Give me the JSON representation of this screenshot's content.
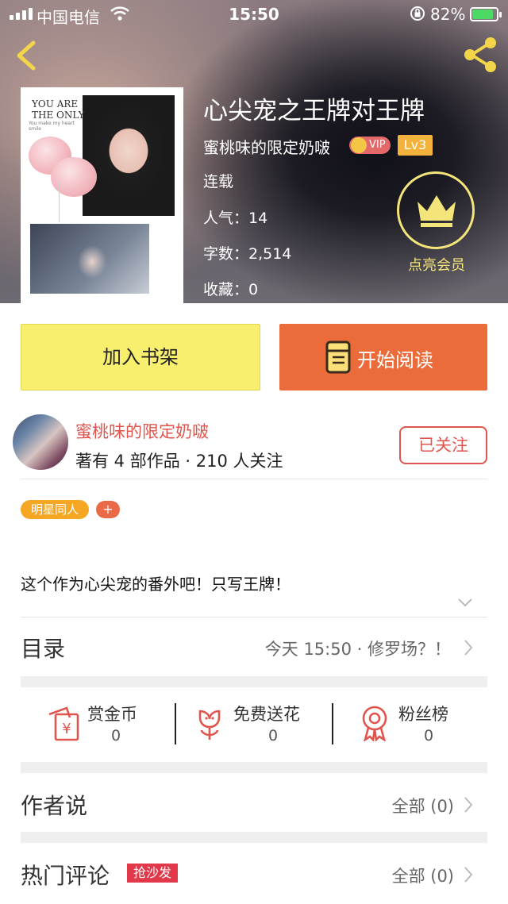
{
  "status_bar": {
    "carrier": "中国电信",
    "time": "15:50",
    "battery": "82%",
    "battery_level": 0.82
  },
  "book": {
    "title": "心尖宠之王牌对王牌",
    "author": "蜜桃味的限定奶啵",
    "vip_label": "VIP",
    "level": "Lv3",
    "status": "连载",
    "popularity": "人气：14",
    "word_count": "字数：2,514",
    "favorites": "收藏：0",
    "cover_text_title": "YOU ARE THE ONLY",
    "cover_text_sub": "You make my heart smile"
  },
  "membership": {
    "label": "点亮会员",
    "icon": "crown-icon"
  },
  "actions": {
    "add_shelf": "加入书架",
    "start_reading": "开始阅读"
  },
  "author_card": {
    "name": "蜜桃味的限定奶啵",
    "stats": "著有 4 部作品 · 210 人关注",
    "follow_label": "已关注"
  },
  "tags": {
    "items": [
      "明星同人"
    ],
    "add": "+"
  },
  "description": "这个作为心尖宠的番外吧！只写王牌！",
  "toc": {
    "title": "目录",
    "latest": "今天 15:50 · 修罗场？！"
  },
  "stats": {
    "coins": {
      "label": "赏金币",
      "value": "0"
    },
    "flowers": {
      "label": "免费送花",
      "value": "0"
    },
    "fans": {
      "label": "粉丝榜",
      "value": "0"
    }
  },
  "author_says": {
    "title": "作者说",
    "all": "全部 (0)"
  },
  "hot_comments": {
    "title": "热门评论",
    "badge": "抢沙发",
    "all": "全部 (0)"
  },
  "colors": {
    "accent_orange": "#ec6b3b",
    "accent_yellow": "#f8ef6e",
    "author_red": "#e0564e",
    "member_gold": "#f3e57a"
  }
}
